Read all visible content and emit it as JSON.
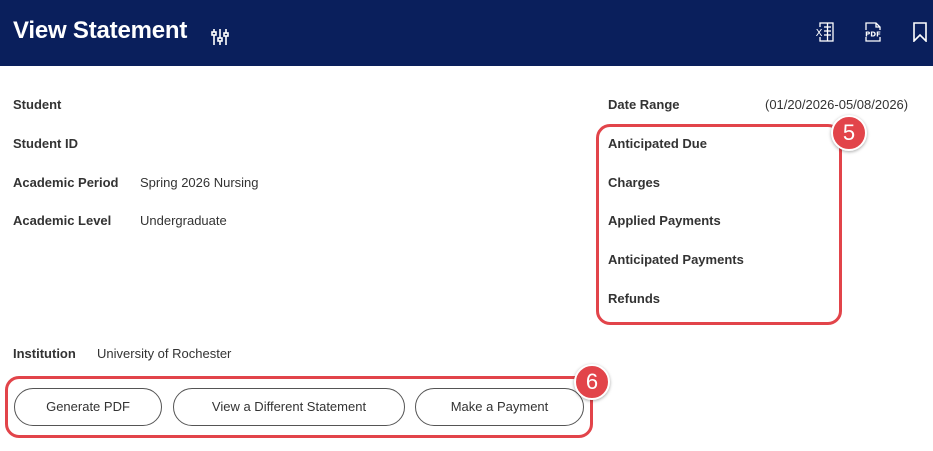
{
  "header": {
    "title": "View Statement",
    "icons": {
      "tune": "tune-icon",
      "excel": "excel-export-icon",
      "pdf": "pdf-export-icon",
      "bookmark": "bookmark-icon"
    },
    "pdf_icon_text": "PDF",
    "excel_icon_text": "X"
  },
  "left_fields": {
    "student_label": "Student",
    "student_id_label": "Student ID",
    "academic_period_label": "Academic Period",
    "academic_period_value": "Spring 2026 Nursing",
    "academic_level_label": "Academic Level",
    "academic_level_value": "Undergraduate",
    "institution_label": "Institution",
    "institution_value": "University of Rochester"
  },
  "right_fields": {
    "date_range_label": "Date Range",
    "date_range_value": "(01/20/2026-05/08/2026)",
    "anticipated_due_label": "Anticipated Due",
    "charges_label": "Charges",
    "applied_payments_label": "Applied Payments",
    "anticipated_payments_label": "Anticipated Payments",
    "refunds_label": "Refunds"
  },
  "buttons": {
    "generate_pdf": "Generate PDF",
    "view_different": "View a Different Statement",
    "make_payment": "Make a Payment"
  },
  "callouts": {
    "summary_badge": "5",
    "buttons_badge": "6"
  },
  "colors": {
    "header_bg": "#0a1f5c",
    "callout": "#e2444a"
  }
}
